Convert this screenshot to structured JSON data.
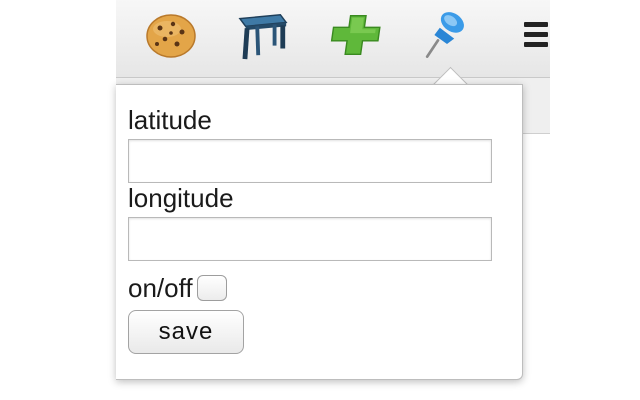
{
  "toolbar": {
    "icons": [
      "cookie-icon",
      "stool-icon",
      "green-cross-icon",
      "pushpin-icon",
      "menu-icon"
    ]
  },
  "popup": {
    "latitude_label": "latitude",
    "latitude_value": "",
    "longitude_label": "longitude",
    "longitude_value": "",
    "toggle_label": "on/off",
    "toggle_checked": false,
    "save_label": "save"
  },
  "colors": {
    "pin_blue": "#3b9be8",
    "cross_green": "#5fb83a",
    "cookie_tan": "#e3a548",
    "stool_blue": "#2d5a7f"
  }
}
